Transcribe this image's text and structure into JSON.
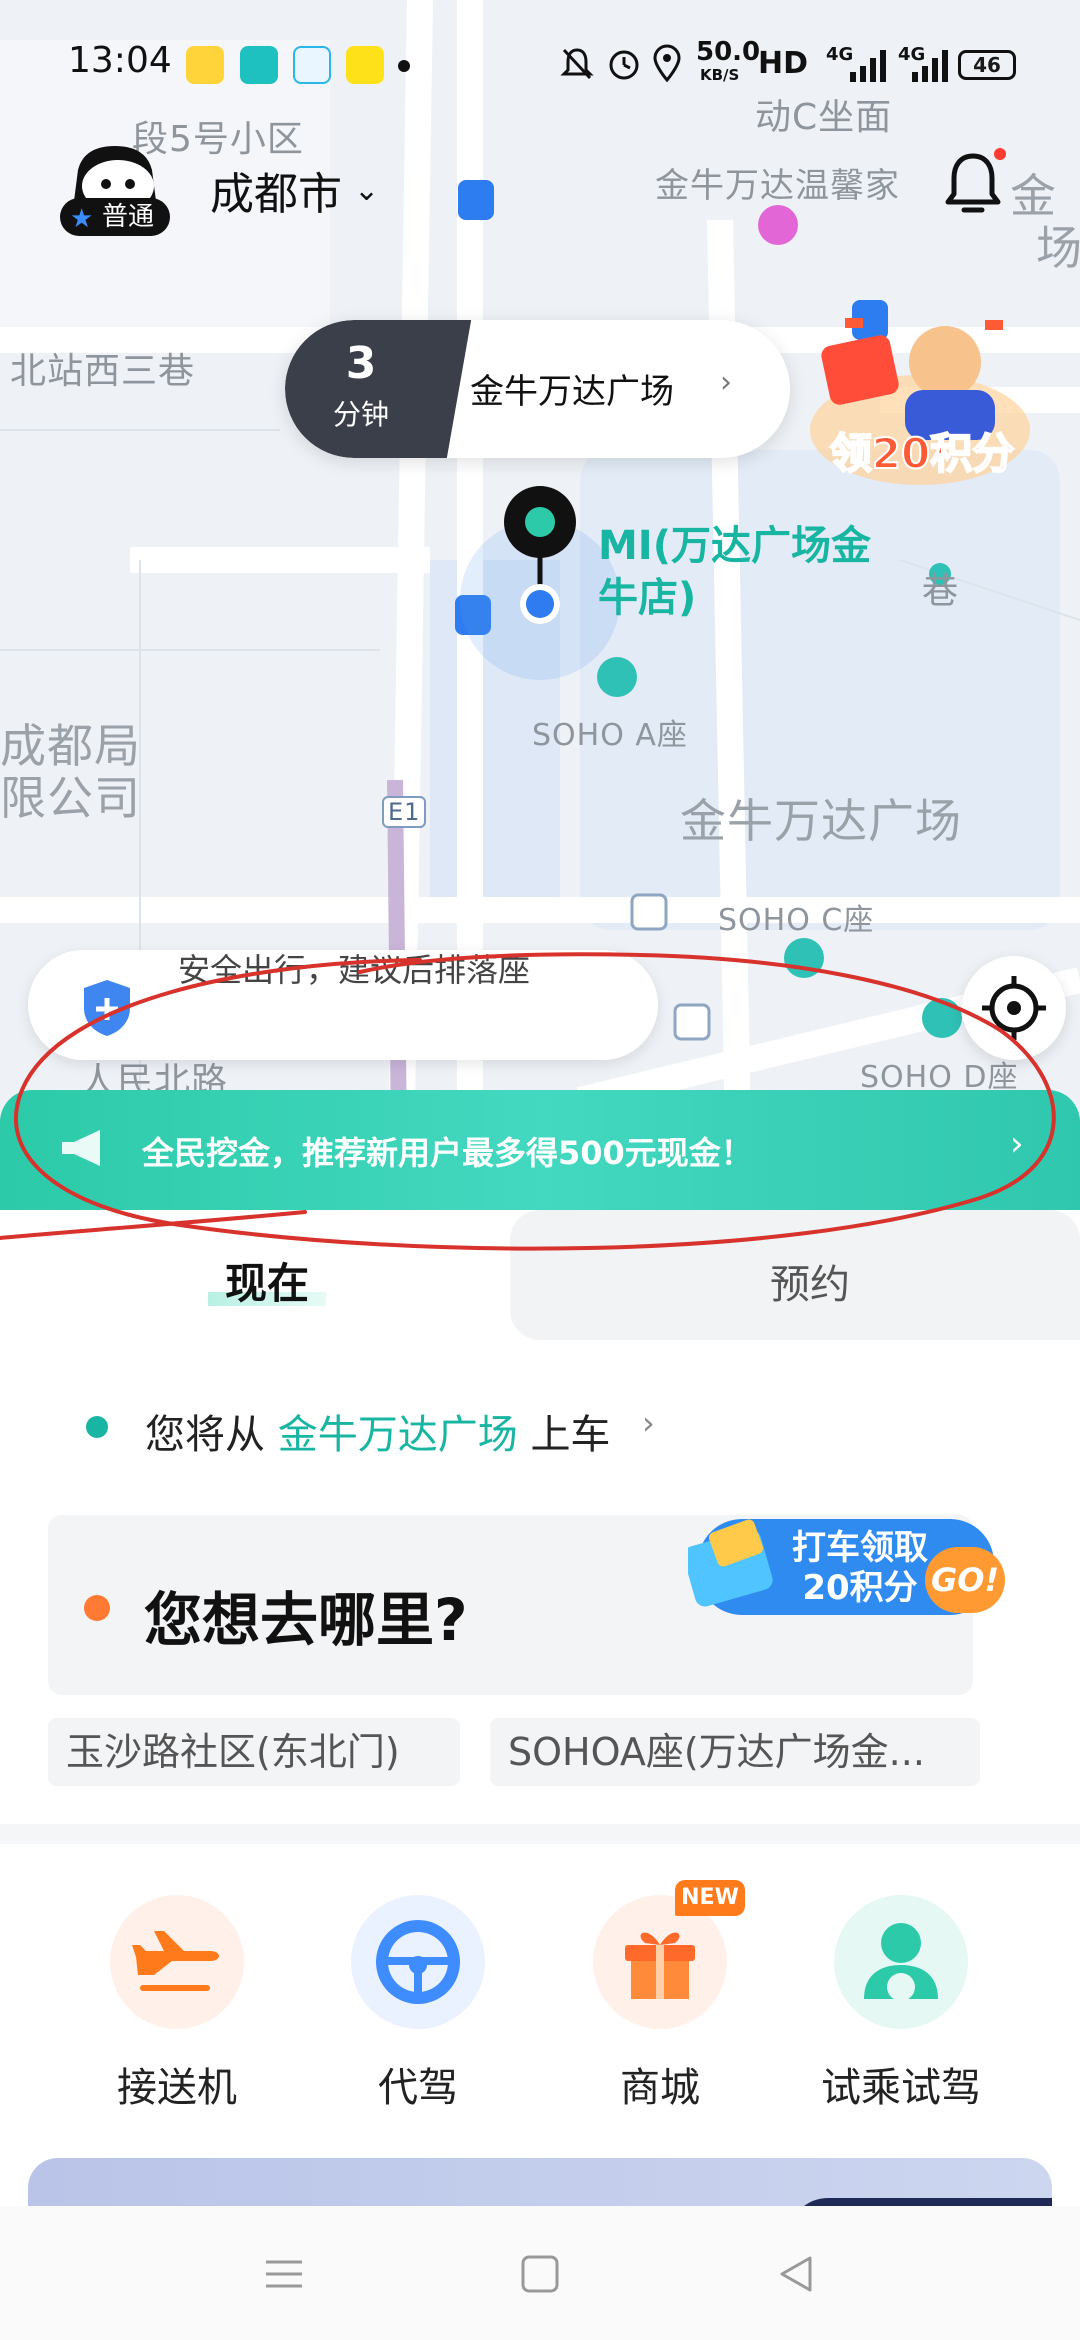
{
  "status_bar": {
    "time": "13:04",
    "network_speed": "50.0",
    "network_speed_unit": "KB/S",
    "hd": "HD",
    "signal_1": "4G",
    "signal_2": "4G",
    "battery": "46",
    "app_icons": [
      "weibo-icon",
      "boss-zhipin-icon",
      "bilibili-icon",
      "xianyu-icon"
    ],
    "indicators": [
      "mute-icon",
      "alarm-icon",
      "location-icon"
    ]
  },
  "header": {
    "city": "成都市",
    "membership": "普通",
    "bell_has_dot": true
  },
  "map": {
    "labels": {
      "community": "段5号小区",
      "top_right_1": "动C坐面",
      "hotel": "金牛万达温馨家",
      "street_left": "北站西三巷",
      "bureau_1": "成都局",
      "bureau_2": "限公司",
      "soho_a": "SOHO A座",
      "wanda_plaza": "金牛万达广场",
      "soho_c": "SOHO C座",
      "soho_d": "SOHO D座",
      "road_bottom": "人民北路",
      "right_edge_1": "金",
      "right_edge_2": "场",
      "lane_right": "巷",
      "e1": "E1"
    },
    "colors": {
      "teal": "#18b5a2",
      "road": "#ffffff",
      "land": "#eef2f7"
    }
  },
  "eta_pill": {
    "minutes": "3",
    "unit": "分钟",
    "place": "金牛万达广场"
  },
  "promo_floater": {
    "text": "领20积分"
  },
  "pin": {
    "poi_name": "MI(万达广场金牛店)"
  },
  "safety_tip": {
    "text": "安全出行，建议后排落座"
  },
  "banner": {
    "text": "全民挖金，推荐新用户最多得500元现金！"
  },
  "tabs": [
    {
      "label": "现在",
      "active": true
    },
    {
      "label": "预约",
      "active": false
    }
  ],
  "pickup": {
    "prefix": "您将从",
    "place": "金牛万达广场",
    "suffix": "上车"
  },
  "destination": {
    "placeholder": "您想去哪里?",
    "promo_text": "打车领取20积分",
    "promo_go": "GO!"
  },
  "recent_places": [
    "玉沙路社区(东北门)",
    "SOHOA座(万达广场金..."
  ],
  "services": [
    {
      "label": "接送机",
      "icon": "airplane-icon",
      "color": "#ff7a1a"
    },
    {
      "label": "代驾",
      "icon": "steering-wheel-icon",
      "color": "#3f8cff"
    },
    {
      "label": "商城",
      "icon": "gift-icon",
      "color": "#ff6a2a",
      "badge": "NEW"
    },
    {
      "label": "试乘试驾",
      "icon": "driver-icon",
      "color": "#2ccaa9"
    }
  ],
  "accent_colors": {
    "teal": "#2ccaa9",
    "orange": "#ff7a33",
    "annotation_red": "#d8322c"
  }
}
